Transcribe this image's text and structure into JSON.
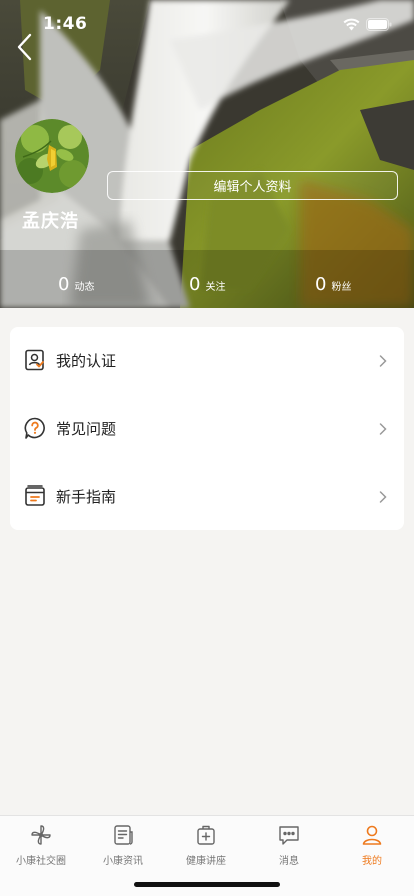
{
  "status_bar": {
    "time": "1:46"
  },
  "profile": {
    "name": "孟庆浩",
    "edit_button": "编辑个人资料",
    "stats": [
      {
        "count": "0",
        "label": "动态"
      },
      {
        "count": "0",
        "label": "关注"
      },
      {
        "count": "0",
        "label": "粉丝"
      }
    ]
  },
  "menu": {
    "items": [
      {
        "label": "我的认证",
        "icon": "certification-icon"
      },
      {
        "label": "常见问题",
        "icon": "question-icon"
      },
      {
        "label": "新手指南",
        "icon": "guide-icon"
      }
    ]
  },
  "tabbar": {
    "active_color": "#ee7a1e",
    "items": [
      {
        "label": "小康社交圈",
        "icon": "pinwheel-icon"
      },
      {
        "label": "小康资讯",
        "icon": "news-icon"
      },
      {
        "label": "健康讲座",
        "icon": "medical-bag-icon"
      },
      {
        "label": "消息",
        "icon": "chat-bubble-icon"
      },
      {
        "label": "我的",
        "icon": "person-icon",
        "active": true
      }
    ]
  }
}
